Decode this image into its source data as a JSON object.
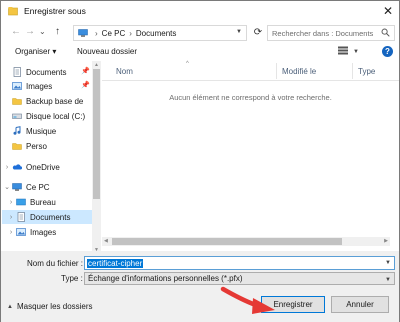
{
  "window": {
    "title": "Enregistrer sous",
    "close_glyph": "✕"
  },
  "nav": {
    "back": "←",
    "forward": "→",
    "recent": "⌄",
    "up": "↑",
    "breadcrumb": [
      "Ce PC",
      "Documents"
    ],
    "search_placeholder": "Rechercher dans : Documents"
  },
  "toolbar": {
    "organize": "Organiser ▾",
    "new_folder": "Nouveau dossier"
  },
  "sidebar": {
    "items": [
      {
        "label": "Documents",
        "icon": "documents-icon",
        "pinned": true
      },
      {
        "label": "Images",
        "icon": "images-icon",
        "pinned": true
      },
      {
        "label": "Backup base de",
        "icon": "folder-icon"
      },
      {
        "label": "Disque local (C:)",
        "icon": "drive-icon"
      },
      {
        "label": "Musique",
        "icon": "music-icon"
      },
      {
        "label": "Perso",
        "icon": "folder-icon"
      },
      {
        "label": "OneDrive",
        "icon": "onedrive-icon",
        "expand": ">"
      },
      {
        "label": "Ce PC",
        "icon": "pc-icon",
        "expand": "v"
      },
      {
        "label": "Bureau",
        "icon": "desktop-icon",
        "expand": ">"
      },
      {
        "label": "Documents",
        "icon": "documents-icon",
        "expand": ">",
        "selected": true
      },
      {
        "label": "Images",
        "icon": "images-icon",
        "expand": ">"
      }
    ]
  },
  "columns": [
    "Nom",
    "Modifié le",
    "Type"
  ],
  "empty_message": "Aucun élément ne correspond à votre recherche.",
  "form": {
    "filename_label": "Nom du fichier :",
    "filename_value": "certificat-cipher",
    "filetype_label": "Type :",
    "filetype_value": "Échange d'informations personnelles (*.pfx)"
  },
  "footer": {
    "hide_folders": "Masquer les dossiers",
    "save": "Enregistrer",
    "cancel": "Annuler"
  },
  "colors": {
    "accent": "#0078d7",
    "selection": "#cce8ff",
    "arrow": "#e53935"
  }
}
